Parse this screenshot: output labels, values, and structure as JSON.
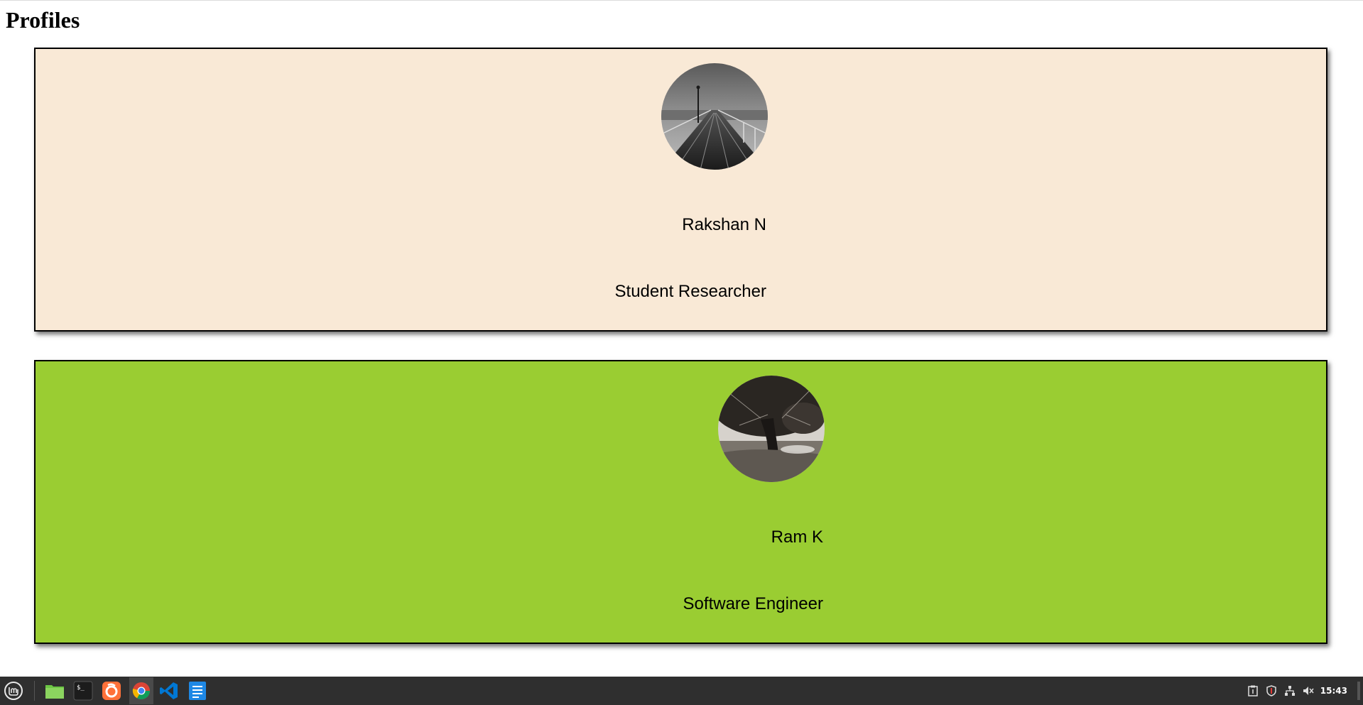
{
  "page": {
    "title": "Profiles"
  },
  "profiles": [
    {
      "name": "Rakshan N",
      "role": "Student Researcher",
      "background": "#f9e9d6",
      "avatar_icon": "pier-photo"
    },
    {
      "name": "Ram K",
      "role": "Software Engineer",
      "background": "#9acd32",
      "avatar_icon": "tree-photo"
    }
  ],
  "taskbar": {
    "apps": [
      {
        "icon": "linux-mint-menu-icon"
      },
      {
        "icon": "files-folder-icon"
      },
      {
        "icon": "terminal-icon"
      },
      {
        "icon": "firefox-icon"
      },
      {
        "icon": "chrome-icon"
      },
      {
        "icon": "vscode-icon"
      },
      {
        "icon": "text-editor-icon"
      }
    ],
    "tray": [
      "clipboard-icon",
      "shield-icon",
      "network-icon",
      "volume-muted-icon"
    ],
    "clock": "15:43"
  }
}
